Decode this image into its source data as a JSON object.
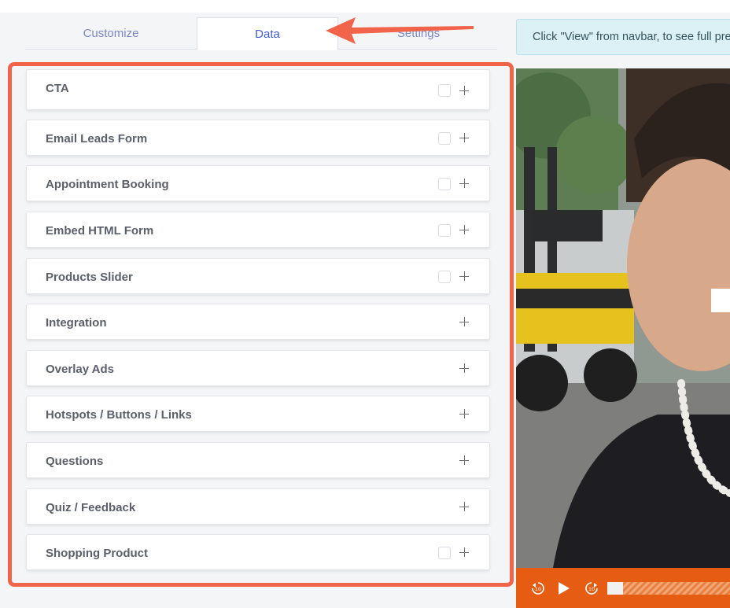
{
  "tabs": [
    {
      "label": "Customize",
      "active": false
    },
    {
      "label": "Data",
      "active": true
    },
    {
      "label": "Settings",
      "active": false
    }
  ],
  "notice": "Click \"View\" from navbar, to see full preview",
  "items": [
    {
      "label": "CTA",
      "checkbox": true
    },
    {
      "label": "Email Leads Form",
      "checkbox": true
    },
    {
      "label": "Appointment Booking",
      "checkbox": true
    },
    {
      "label": "Embed HTML Form",
      "checkbox": true
    },
    {
      "label": "Products Slider",
      "checkbox": true
    },
    {
      "label": "Integration",
      "checkbox": false
    },
    {
      "label": "Overlay Ads",
      "checkbox": false
    },
    {
      "label": "Hotspots / Buttons / Links",
      "checkbox": false
    },
    {
      "label": "Questions",
      "checkbox": false
    },
    {
      "label": "Quiz / Feedback",
      "checkbox": false
    },
    {
      "label": "Shopping Product",
      "checkbox": true
    }
  ],
  "player": {
    "rewind_label": "10",
    "forward_label": "10",
    "progress": 0.02
  },
  "colors": {
    "highlight": "#f2644a",
    "tab_active": "#3d5ed6",
    "tab_inactive": "#7b86c9",
    "player_bar": "#e55c12"
  }
}
